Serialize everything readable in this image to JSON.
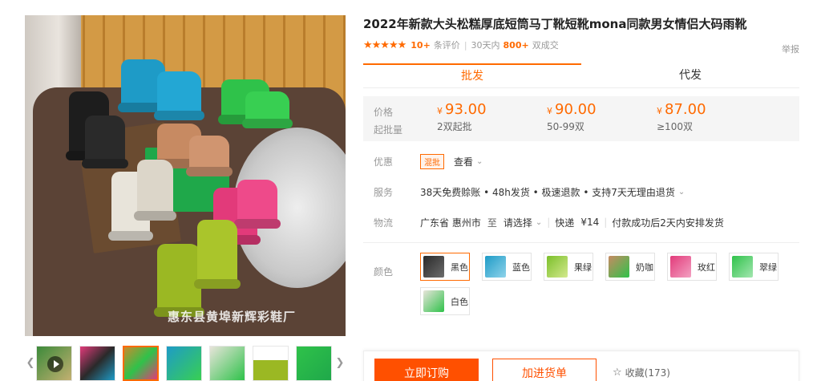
{
  "product": {
    "title": "2022年新款大头松糕厚底短筒马丁靴短靴mona同款男女情侣大码雨靴",
    "stars": "★★★★★",
    "review_count": "10+",
    "review_label": "条评价",
    "sales_prefix": "30天内",
    "sales_count": "800+",
    "sales_suffix": "双成交",
    "report": "举报"
  },
  "gallery": {
    "watermark": "惠东县黄埠新辉彩鞋厂",
    "thumbs": [
      "video",
      "pink-mix",
      "boots-group",
      "green-pair",
      "green-pair-2",
      "lime-single",
      "green-box"
    ],
    "active_thumb": 2
  },
  "tabs": [
    {
      "label": "批发",
      "active": true
    },
    {
      "label": "代发",
      "active": false
    }
  ],
  "pricing": {
    "price_label": "价格",
    "moq_label": "起批量",
    "currency": "¥",
    "tiers": [
      {
        "price": "93.00",
        "range": "2双起批"
      },
      {
        "price": "90.00",
        "range": "50-99双"
      },
      {
        "price": "87.00",
        "range": "≥100双"
      }
    ]
  },
  "promo": {
    "label": "优惠",
    "badge": "混批",
    "link": "查看"
  },
  "service": {
    "label": "服务",
    "text": "38天免费赊账 • 48h发货 • 极速退款 • 支持7天无理由退货"
  },
  "logistics": {
    "label": "物流",
    "origin": "广东省 惠州市",
    "to": "至",
    "select": "请选择",
    "express_label": "快递",
    "express_fee": "¥14",
    "note": "付款成功后2天内安排发货"
  },
  "colors": {
    "label": "颜色",
    "options": [
      {
        "name": "黑色",
        "swatch": "#2a2a2a",
        "selected": true
      },
      {
        "name": "蓝色",
        "swatch": "#1e9bc7",
        "selected": false
      },
      {
        "name": "果绿",
        "swatch": "#7bbf2a",
        "selected": false
      },
      {
        "name": "奶咖",
        "swatch": "#c78a62",
        "selected": false
      },
      {
        "name": "玫红",
        "swatch": "#e23a7a",
        "selected": false
      },
      {
        "name": "翠绿",
        "swatch": "#2fc24a",
        "selected": false
      },
      {
        "name": "白色",
        "swatch": "#e8e4da",
        "selected": false
      }
    ]
  },
  "actions": {
    "buy": "立即订购",
    "cart": "加进货单",
    "favorite": "收藏(173)"
  },
  "colors_theme": {
    "accent": "#ff6a00",
    "buy": "#ff5000"
  }
}
